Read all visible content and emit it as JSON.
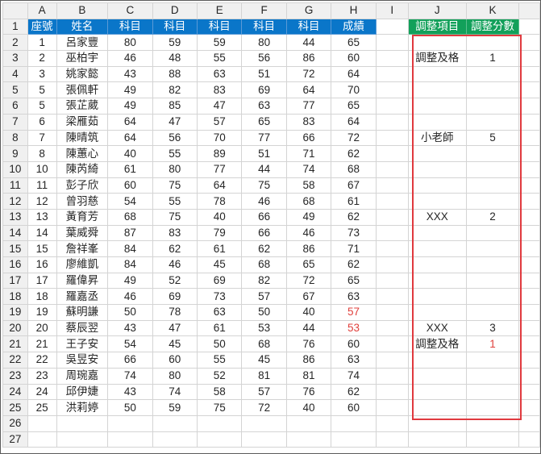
{
  "columns": [
    "A",
    "B",
    "C",
    "D",
    "E",
    "F",
    "G",
    "H",
    "I",
    "J",
    "K"
  ],
  "header_row": {
    "row": "1",
    "seat": "座號",
    "name": "姓名",
    "subjects": [
      "科目",
      "科目",
      "科目",
      "科目",
      "科目"
    ],
    "score": "成績",
    "adj_item": "調整項目",
    "adj_points": "調整分數"
  },
  "rows": [
    {
      "r": "2",
      "seat": "1",
      "name": "呂家豐",
      "c": "80",
      "d": "59",
      "e": "59",
      "f": "80",
      "g": "44",
      "h": "65",
      "j": "",
      "k": ""
    },
    {
      "r": "3",
      "seat": "2",
      "name": "巫柏宇",
      "c": "46",
      "d": "48",
      "e": "55",
      "f": "56",
      "g": "86",
      "h": "60",
      "j": "調整及格",
      "k": "1"
    },
    {
      "r": "4",
      "seat": "3",
      "name": "姚家懿",
      "c": "43",
      "d": "88",
      "e": "63",
      "f": "51",
      "g": "72",
      "h": "64",
      "j": "",
      "k": ""
    },
    {
      "r": "5",
      "seat": "5",
      "name": "張佩軒",
      "c": "49",
      "d": "82",
      "e": "83",
      "f": "69",
      "g": "64",
      "h": "70",
      "j": "",
      "k": ""
    },
    {
      "r": "6",
      "seat": "5",
      "name": "張芷葳",
      "c": "49",
      "d": "85",
      "e": "47",
      "f": "63",
      "g": "77",
      "h": "65",
      "j": "",
      "k": ""
    },
    {
      "r": "7",
      "seat": "6",
      "name": "梁雁茹",
      "c": "64",
      "d": "47",
      "e": "57",
      "f": "65",
      "g": "83",
      "h": "64",
      "j": "",
      "k": ""
    },
    {
      "r": "8",
      "seat": "7",
      "name": "陳晴筑",
      "c": "64",
      "d": "56",
      "e": "70",
      "f": "77",
      "g": "66",
      "h": "72",
      "j": "小老師",
      "k": "5"
    },
    {
      "r": "9",
      "seat": "8",
      "name": "陳蕙心",
      "c": "40",
      "d": "55",
      "e": "89",
      "f": "51",
      "g": "71",
      "h": "62",
      "j": "",
      "k": ""
    },
    {
      "r": "10",
      "seat": "10",
      "name": "陳芮綺",
      "c": "61",
      "d": "80",
      "e": "77",
      "f": "44",
      "g": "74",
      "h": "68",
      "j": "",
      "k": ""
    },
    {
      "r": "11",
      "seat": "11",
      "name": "彭子欣",
      "c": "60",
      "d": "75",
      "e": "64",
      "f": "75",
      "g": "58",
      "h": "67",
      "j": "",
      "k": ""
    },
    {
      "r": "12",
      "seat": "12",
      "name": "曾羽慈",
      "c": "54",
      "d": "55",
      "e": "78",
      "f": "46",
      "g": "68",
      "h": "61",
      "j": "",
      "k": ""
    },
    {
      "r": "13",
      "seat": "13",
      "name": "黃育芳",
      "c": "68",
      "d": "75",
      "e": "40",
      "f": "66",
      "g": "49",
      "h": "62",
      "j": "XXX",
      "k": "2"
    },
    {
      "r": "14",
      "seat": "14",
      "name": "葉威舜",
      "c": "87",
      "d": "83",
      "e": "79",
      "f": "66",
      "g": "46",
      "h": "73",
      "j": "",
      "k": ""
    },
    {
      "r": "15",
      "seat": "15",
      "name": "詹祥峯",
      "c": "84",
      "d": "62",
      "e": "61",
      "f": "62",
      "g": "86",
      "h": "71",
      "j": "",
      "k": ""
    },
    {
      "r": "16",
      "seat": "16",
      "name": "廖維凱",
      "c": "84",
      "d": "46",
      "e": "45",
      "f": "68",
      "g": "65",
      "h": "62",
      "j": "",
      "k": ""
    },
    {
      "r": "17",
      "seat": "17",
      "name": "羅偉昇",
      "c": "49",
      "d": "52",
      "e": "69",
      "f": "82",
      "g": "72",
      "h": "65",
      "j": "",
      "k": ""
    },
    {
      "r": "18",
      "seat": "18",
      "name": "羅嘉丞",
      "c": "46",
      "d": "69",
      "e": "73",
      "f": "57",
      "g": "67",
      "h": "63",
      "j": "",
      "k": ""
    },
    {
      "r": "19",
      "seat": "19",
      "name": "蘇明謙",
      "c": "50",
      "d": "78",
      "e": "63",
      "f": "50",
      "g": "40",
      "h": "57",
      "j": "",
      "k": "",
      "red": true
    },
    {
      "r": "20",
      "seat": "20",
      "name": "蔡辰翌",
      "c": "43",
      "d": "47",
      "e": "61",
      "f": "53",
      "g": "44",
      "h": "53",
      "j": "XXX",
      "k": "3",
      "red": true
    },
    {
      "r": "21",
      "seat": "21",
      "name": "王子安",
      "c": "54",
      "d": "45",
      "e": "50",
      "f": "68",
      "g": "76",
      "h": "60",
      "j": "調整及格",
      "k": "1",
      "kred": true
    },
    {
      "r": "22",
      "seat": "22",
      "name": "吳昱安",
      "c": "66",
      "d": "60",
      "e": "55",
      "f": "45",
      "g": "86",
      "h": "63",
      "j": "",
      "k": ""
    },
    {
      "r": "23",
      "seat": "23",
      "name": "周琬嘉",
      "c": "74",
      "d": "80",
      "e": "52",
      "f": "81",
      "g": "81",
      "h": "74",
      "j": "",
      "k": ""
    },
    {
      "r": "24",
      "seat": "24",
      "name": "邱伊婕",
      "c": "43",
      "d": "74",
      "e": "58",
      "f": "57",
      "g": "76",
      "h": "62",
      "j": "",
      "k": ""
    },
    {
      "r": "25",
      "seat": "25",
      "name": "洪莉婷",
      "c": "50",
      "d": "59",
      "e": "75",
      "f": "72",
      "g": "40",
      "h": "60",
      "j": "",
      "k": ""
    }
  ],
  "empty_rows": [
    "26",
    "27"
  ],
  "colors": {
    "header_blue": "#0a76c9",
    "header_green": "#12a05a",
    "low_score_red": "#e0403c",
    "highlight_box": "#e0393e"
  }
}
